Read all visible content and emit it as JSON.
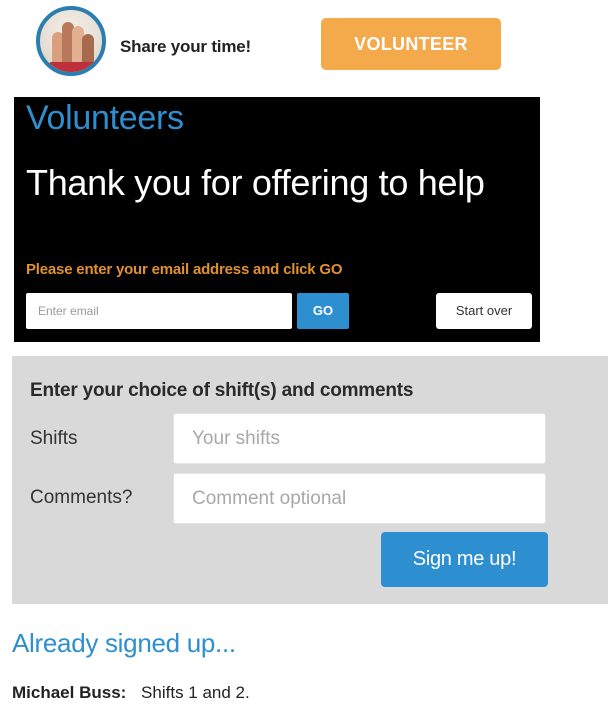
{
  "header": {
    "avatar_icon": "volunteer-hands-icon",
    "tagline": "Share your time!",
    "volunteer_button": "VOLUNTEER"
  },
  "banner": {
    "section_title": "Volunteers",
    "headline": "Thank you for offering to help",
    "instruction": "Please enter your email address and click GO",
    "email_placeholder": "Enter email",
    "email_value": "",
    "go_button": "GO",
    "start_over_button": "Start over"
  },
  "form": {
    "title": "Enter your choice of shift(s) and comments",
    "shifts_label": "Shifts",
    "shifts_placeholder": "Your shifts",
    "shifts_value": "",
    "comments_label": "Comments?",
    "comments_placeholder": "Comment optional",
    "comments_value": "",
    "submit_button": "Sign me up!"
  },
  "signed_up": {
    "title": "Already signed up...",
    "entries": [
      {
        "name": "Michael Buss:",
        "detail": "Shifts 1 and 2."
      }
    ]
  },
  "colors": {
    "accent_blue": "#2e8fd0",
    "orange_button": "#f4a94a",
    "orange_text": "#e0912f",
    "banner_bg": "#000000",
    "panel_bg": "#d9d9d9",
    "avatar_ring": "#2a7fb0"
  }
}
